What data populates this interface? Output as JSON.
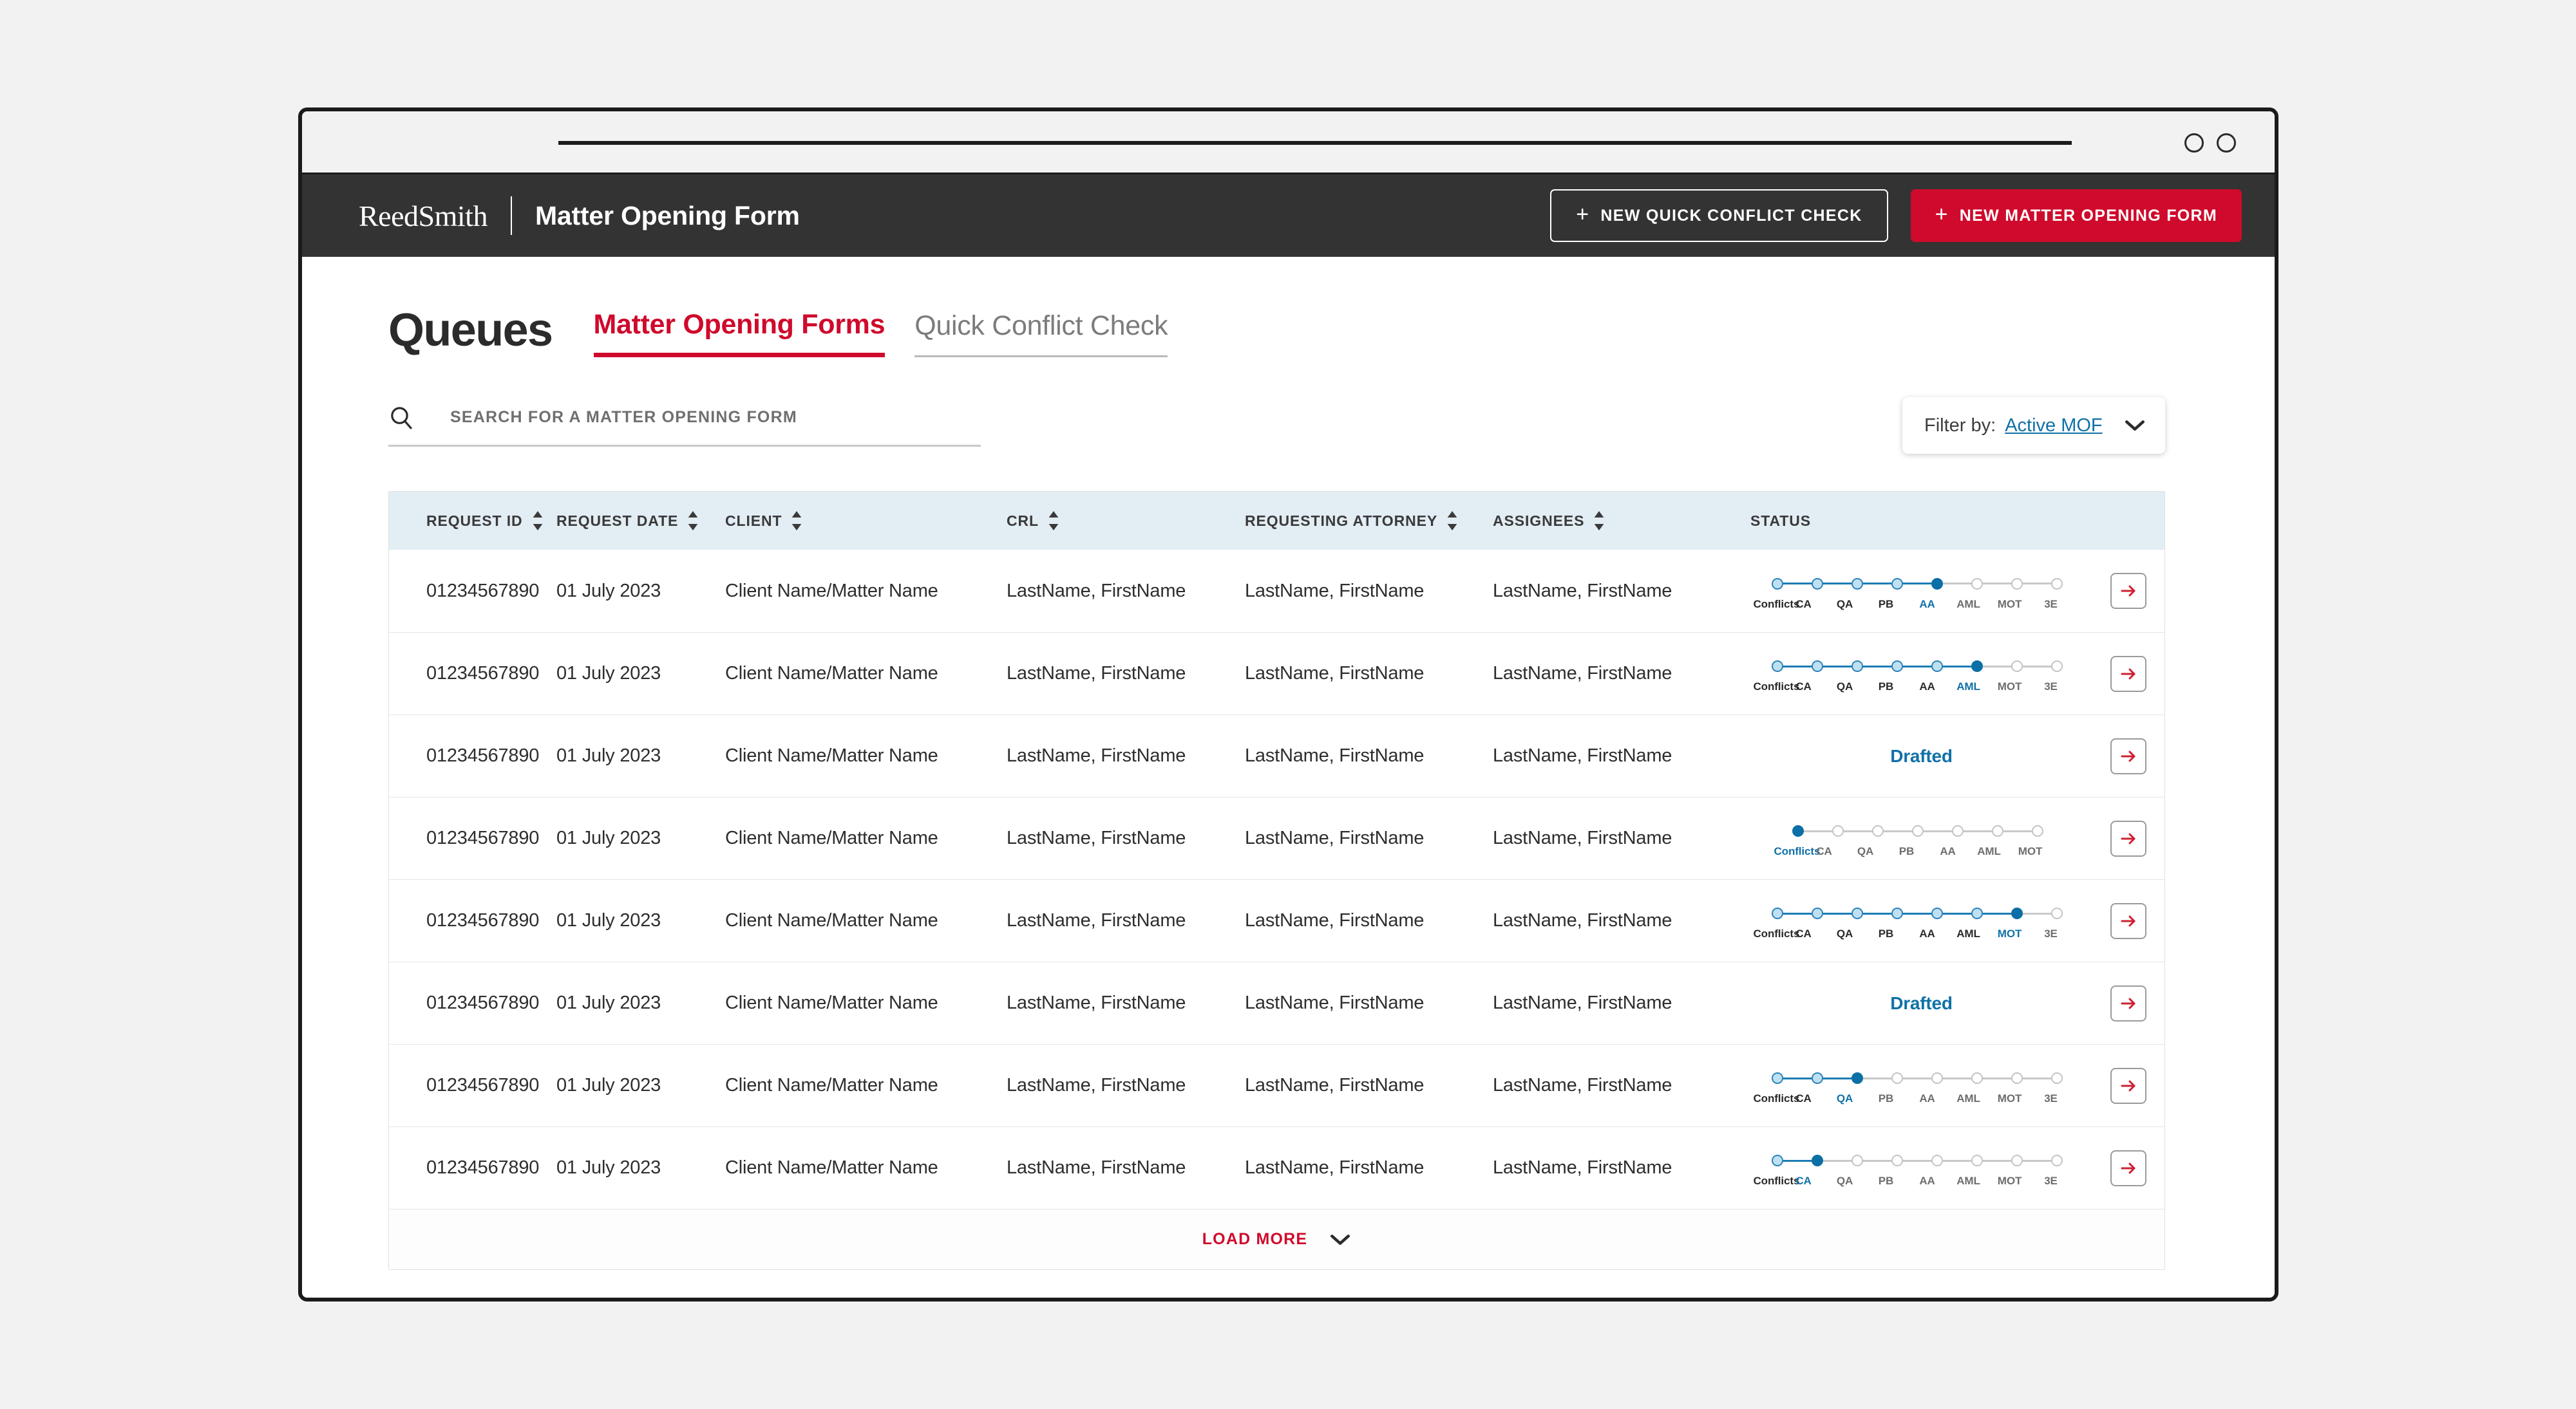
{
  "browser": {
    "address_bar_placeholder": "",
    "window_controls": [
      "circle-1",
      "circle-2"
    ]
  },
  "appbar": {
    "brand": "ReedSmith",
    "title": "Matter Opening Form",
    "buttons": [
      {
        "name": "new-quick-conflict-check-button",
        "label": "NEW QUICK CONFLICT CHECK",
        "icon": "plus-icon",
        "style": "outline"
      },
      {
        "name": "new-matter-opening-form-button",
        "label": "NEW MATTER OPENING FORM",
        "icon": "plus-icon",
        "style": "filled"
      }
    ]
  },
  "page": {
    "title": "Queues",
    "tabs": [
      {
        "label": "Matter Opening Forms",
        "active": true
      },
      {
        "label": "Quick Conflict Check",
        "active": false
      }
    ]
  },
  "search": {
    "icon": "search-icon",
    "placeholder": "SEARCH FOR A MATTER OPENING FORM",
    "value": ""
  },
  "filter": {
    "label": "Filter by:",
    "value": "Active MOF",
    "icon": "chevron-down-icon"
  },
  "table": {
    "columns": [
      {
        "key": "request_id",
        "label": "REQUEST ID",
        "sortable": true
      },
      {
        "key": "request_date",
        "label": "REQUEST DATE",
        "sortable": true
      },
      {
        "key": "client",
        "label": "CLIENT",
        "sortable": true
      },
      {
        "key": "crl",
        "label": "CRL",
        "sortable": true
      },
      {
        "key": "requesting_attorney",
        "label": "REQUESTING ATTORNEY",
        "sortable": true
      },
      {
        "key": "assignees",
        "label": "ASSIGNEES",
        "sortable": true
      },
      {
        "key": "status",
        "label": "STATUS",
        "sortable": false
      }
    ],
    "rows": [
      {
        "request_id": "01234567890",
        "request_date": "01 July 2023",
        "client": "Client Name/Matter Name",
        "crl": "LastName, FirstName",
        "requesting_attorney": "LastName, FirstName",
        "assignees": "LastName, FirstName",
        "status_type": "stepper",
        "steps": [
          "Conflicts",
          "CA",
          "QA",
          "PB",
          "AA",
          "AML",
          "MOT",
          "3E"
        ],
        "current_step_index": 4
      },
      {
        "request_id": "01234567890",
        "request_date": "01 July 2023",
        "client": "Client Name/Matter Name",
        "crl": "LastName, FirstName",
        "requesting_attorney": "LastName, FirstName",
        "assignees": "LastName, FirstName",
        "status_type": "stepper",
        "steps": [
          "Conflicts",
          "CA",
          "QA",
          "PB",
          "AA",
          "AML",
          "MOT",
          "3E"
        ],
        "current_step_index": 5
      },
      {
        "request_id": "01234567890",
        "request_date": "01 July 2023",
        "client": "Client Name/Matter Name",
        "crl": "LastName, FirstName",
        "requesting_attorney": "LastName, FirstName",
        "assignees": "LastName, FirstName",
        "status_type": "text",
        "status_text": "Drafted"
      },
      {
        "request_id": "01234567890",
        "request_date": "01 July 2023",
        "client": "Client Name/Matter Name",
        "crl": "LastName, FirstName",
        "requesting_attorney": "LastName, FirstName",
        "assignees": "LastName, FirstName",
        "status_type": "stepper",
        "steps": [
          "Conflicts",
          "CA",
          "QA",
          "PB",
          "AA",
          "AML",
          "MOT"
        ],
        "current_step_index": 0
      },
      {
        "request_id": "01234567890",
        "request_date": "01 July 2023",
        "client": "Client Name/Matter Name",
        "crl": "LastName, FirstName",
        "requesting_attorney": "LastName, FirstName",
        "assignees": "LastName, FirstName",
        "status_type": "stepper",
        "steps": [
          "Conflicts",
          "CA",
          "QA",
          "PB",
          "AA",
          "AML",
          "MOT",
          "3E"
        ],
        "current_step_index": 6
      },
      {
        "request_id": "01234567890",
        "request_date": "01 July 2023",
        "client": "Client Name/Matter Name",
        "crl": "LastName, FirstName",
        "requesting_attorney": "LastName, FirstName",
        "assignees": "LastName, FirstName",
        "status_type": "text",
        "status_text": "Drafted"
      },
      {
        "request_id": "01234567890",
        "request_date": "01 July 2023",
        "client": "Client Name/Matter Name",
        "crl": "LastName, FirstName",
        "requesting_attorney": "LastName, FirstName",
        "assignees": "LastName, FirstName",
        "status_type": "stepper",
        "steps": [
          "Conflicts",
          "CA",
          "QA",
          "PB",
          "AA",
          "AML",
          "MOT",
          "3E"
        ],
        "current_step_index": 2
      },
      {
        "request_id": "01234567890",
        "request_date": "01 July 2023",
        "client": "Client Name/Matter Name",
        "crl": "LastName, FirstName",
        "requesting_attorney": "LastName, FirstName",
        "assignees": "LastName, FirstName",
        "status_type": "stepper",
        "steps": [
          "Conflicts",
          "CA",
          "QA",
          "PB",
          "AA",
          "AML",
          "MOT",
          "3E"
        ],
        "current_step_index": 1
      }
    ],
    "row_action_icon": "arrow-right-icon"
  },
  "load_more": {
    "label": "LOAD MORE",
    "icon": "chevron-down-icon"
  },
  "colors": {
    "brand_red": "#cf0a2c",
    "appbar_dark": "#333333",
    "table_header_blue": "#e3edf4",
    "step_current_blue": "#0c6fa6",
    "step_done_fill": "#bfe0f2",
    "link_blue": "#1071a8",
    "page_background": "#f2f2f2"
  }
}
